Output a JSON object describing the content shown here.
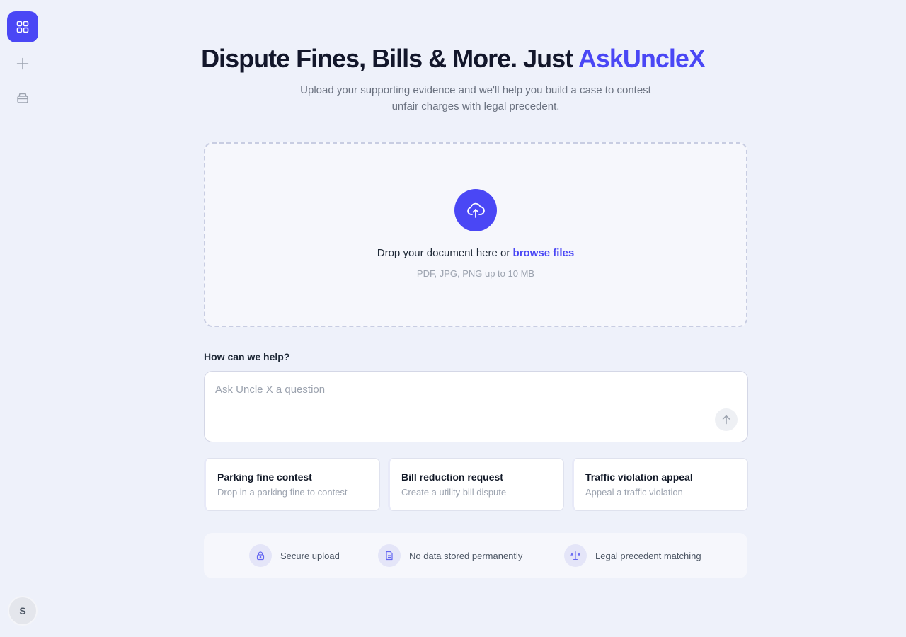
{
  "sidebar": {
    "items": [
      {
        "icon": "grid-icon",
        "active": true
      },
      {
        "icon": "plus-icon",
        "active": false
      },
      {
        "icon": "archive-icon",
        "active": false
      }
    ],
    "user_initial": "S"
  },
  "header": {
    "title_prefix": "Dispute Fines, Bills & More. Just ",
    "title_brand": "AskUncleX",
    "subtitle": "Upload your supporting evidence and we'll help you build a case to contest unfair charges with legal precedent."
  },
  "dropzone": {
    "icon": "cloud-upload-icon",
    "text": "Drop your document here or ",
    "link": "browse files",
    "hint": "PDF, JPG, PNG up to 10 MB"
  },
  "question": {
    "label": "How can we help?",
    "placeholder": "Ask Uncle X a question",
    "value": "",
    "send_icon": "arrow-up-icon"
  },
  "cards": [
    {
      "title": "Parking fine contest",
      "desc": "Drop in a parking fine to contest"
    },
    {
      "title": "Bill reduction request",
      "desc": "Create a utility bill dispute"
    },
    {
      "title": "Traffic violation appeal",
      "desc": "Appeal a traffic violation"
    }
  ],
  "features": [
    {
      "icon": "lock-icon",
      "label": "Secure upload"
    },
    {
      "icon": "document-icon",
      "label": "No data stored permanently"
    },
    {
      "icon": "scales-icon",
      "label": "Legal precedent matching"
    }
  ],
  "colors": {
    "accent": "#4a47f5",
    "background": "#eef1fa"
  }
}
